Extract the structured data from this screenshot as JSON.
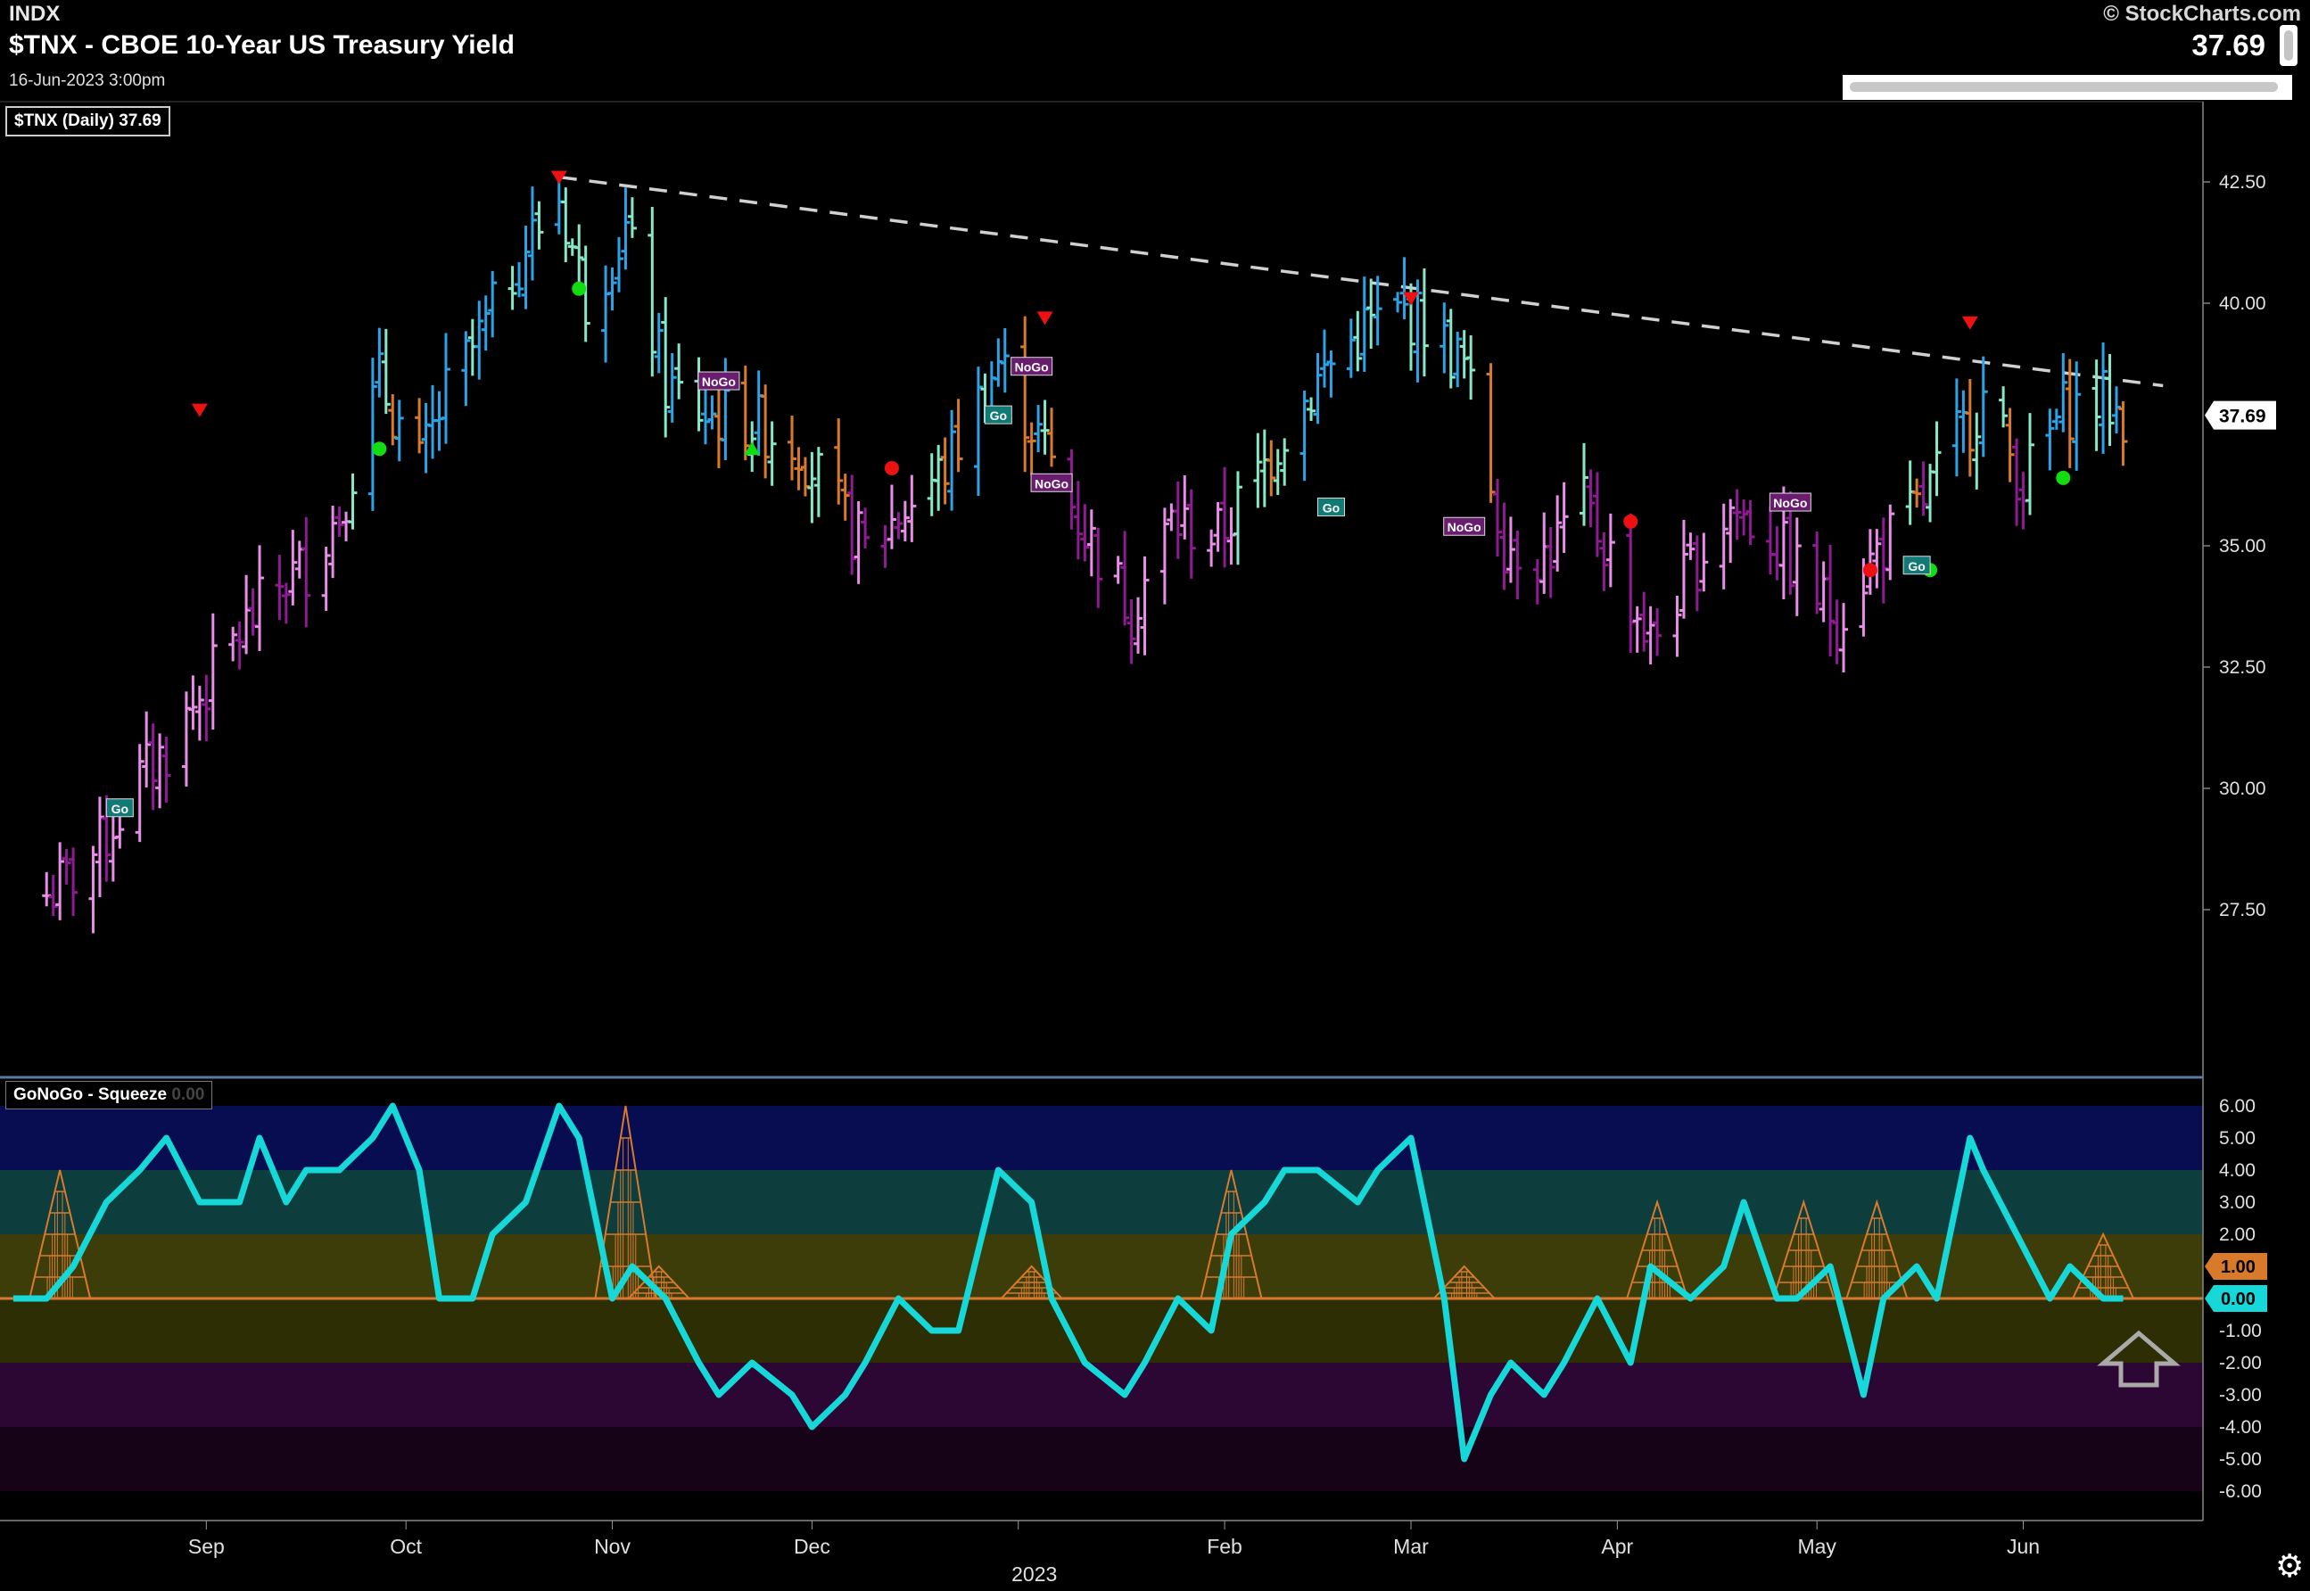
{
  "header": {
    "exchange": "INDX",
    "title": "$TNX - CBOE 10-Year US Treasury Yield",
    "datetime": "16-Jun-2023 3:00pm",
    "copyright": "© StockCharts.com",
    "last_value": "37.69"
  },
  "price_panel": {
    "legend": "$TNX (Daily) 37.69",
    "last_value_tag": "37.69"
  },
  "oscillator_panel": {
    "legend": "GoNoGo - Squeeze",
    "legend_dim": "0.00",
    "tag_upper": "1.00",
    "tag_lower": "0.00"
  },
  "colors": {
    "go_strong": "#2ba3e6",
    "go_weak": "#87e8c8",
    "nogo_strong": "#8e1b94",
    "nogo_weak": "#e88ee8",
    "amber": "#d97a2b",
    "oscillator": "#16d8d8",
    "squeeze": "#d97a2b",
    "trendline": "#d0d0d0",
    "red_marker": "#ee1111",
    "green_marker": "#11dd11"
  },
  "chart_data": [
    {
      "type": "ohlc",
      "title": "$TNX (Daily)",
      "ylim": [
        25.5,
        44.0
      ],
      "y_ticks": [
        "42.50",
        "40.00",
        "35.00",
        "32.50",
        "30.00",
        "27.50"
      ],
      "x_ticks": [
        "Sep",
        "Oct",
        "Nov",
        "Dec",
        "2023",
        "Feb",
        "Mar",
        "Apr",
        "May",
        "Jun"
      ],
      "x_ticks_note": "month labels at start of each month; '2023' printed below January",
      "trendline": {
        "x": [
          "2022-10-24",
          "2023-06-22"
        ],
        "y": [
          42.6,
          38.3
        ],
        "style": "dashed"
      },
      "series_close": {
        "x": [
          "2022-08-08",
          "2022-08-12",
          "2022-08-16",
          "2022-08-22",
          "2022-08-26",
          "2022-08-31",
          "2022-09-06",
          "2022-09-12",
          "2022-09-16",
          "2022-09-21",
          "2022-09-27",
          "2022-10-03",
          "2022-10-07",
          "2022-10-13",
          "2022-10-19",
          "2022-10-24",
          "2022-10-28",
          "2022-11-03",
          "2022-11-09",
          "2022-11-15",
          "2022-11-21",
          "2022-11-29",
          "2022-12-05",
          "2022-12-09",
          "2022-12-15",
          "2022-12-21",
          "2022-12-29",
          "2023-01-05",
          "2023-01-11",
          "2023-01-18",
          "2023-01-24",
          "2023-01-31",
          "2023-02-06",
          "2023-02-10",
          "2023-02-16",
          "2023-02-22",
          "2023-02-28",
          "2023-03-03",
          "2023-03-09",
          "2023-03-15",
          "2023-03-21",
          "2023-03-27",
          "2023-03-31",
          "2023-04-06",
          "2023-04-12",
          "2023-04-18",
          "2023-04-24",
          "2023-04-28",
          "2023-05-04",
          "2023-05-10",
          "2023-05-16",
          "2023-05-22",
          "2023-05-26",
          "2023-06-01",
          "2023-06-07",
          "2023-06-13",
          "2023-06-16"
        ],
        "y": [
          27.8,
          28.2,
          28.8,
          30.2,
          30.8,
          31.9,
          33.2,
          34.2,
          34.6,
          35.7,
          38.4,
          36.6,
          38.1,
          39.5,
          41.2,
          42.2,
          40.1,
          41.5,
          38.3,
          37.7,
          37.6,
          37.1,
          35.7,
          34.9,
          35.8,
          36.6,
          38.8,
          37.0,
          35.3,
          33.7,
          35.5,
          35.2,
          36.4,
          37.4,
          38.6,
          39.5,
          39.8,
          39.6,
          38.7,
          35.1,
          34.8,
          35.8,
          34.8,
          33.0,
          34.5,
          35.8,
          35.2,
          34.5,
          33.5,
          34.9,
          35.7,
          37.2,
          38.0,
          36.3,
          37.8,
          38.0,
          37.69
        ]
      },
      "markers": [
        {
          "type": "down-triangle",
          "color": "red",
          "label": "",
          "x": "2022-08-31",
          "y": 37.8
        },
        {
          "type": "down-triangle",
          "color": "red",
          "label": "",
          "x": "2022-10-24",
          "y": 42.6
        },
        {
          "type": "down-triangle",
          "color": "red",
          "label": "",
          "x": "2023-01-05",
          "y": 39.7
        },
        {
          "type": "down-triangle",
          "color": "red",
          "label": "",
          "x": "2023-03-01",
          "y": 40.1
        },
        {
          "type": "down-triangle",
          "color": "red",
          "label": "",
          "x": "2023-05-24",
          "y": 39.6
        },
        {
          "type": "dot",
          "color": "green",
          "x": "2022-10-27",
          "y": 40.3
        },
        {
          "type": "dot",
          "color": "green",
          "x": "2022-09-27",
          "y": 37.0
        },
        {
          "type": "dot",
          "color": "green",
          "x": "2023-05-18",
          "y": 34.5
        },
        {
          "type": "dot",
          "color": "green",
          "x": "2023-06-07",
          "y": 36.4
        },
        {
          "type": "dot",
          "color": "red",
          "x": "2022-12-13",
          "y": 36.6
        },
        {
          "type": "dot",
          "color": "red",
          "x": "2023-04-03",
          "y": 35.5
        },
        {
          "type": "dot",
          "color": "red",
          "x": "2023-05-09",
          "y": 34.5
        },
        {
          "type": "up-triangle",
          "color": "green",
          "x": "2022-11-22",
          "y": 37.0
        },
        {
          "type": "label",
          "label": "Go",
          "x": "2022-08-19",
          "y": 29.6
        },
        {
          "type": "label",
          "label": "NoGo",
          "x": "2022-11-17",
          "y": 38.4
        },
        {
          "type": "label",
          "label": "Go",
          "x": "2022-12-29",
          "y": 37.7
        },
        {
          "type": "label",
          "label": "NoGo",
          "x": "2023-01-03",
          "y": 38.7
        },
        {
          "type": "label",
          "label": "NoGo",
          "x": "2023-01-06",
          "y": 36.3
        },
        {
          "type": "label",
          "label": "Go",
          "x": "2023-02-17",
          "y": 35.8
        },
        {
          "type": "label",
          "label": "NoGo",
          "x": "2023-03-09",
          "y": 35.4
        },
        {
          "type": "label",
          "label": "NoGo",
          "x": "2023-04-27",
          "y": 35.9
        },
        {
          "type": "label",
          "label": "Go",
          "x": "2023-05-16",
          "y": 34.6
        }
      ]
    },
    {
      "type": "line",
      "title": "GoNoGo - Squeeze",
      "ylim": [
        -7.0,
        6.6
      ],
      "y_ticks": [
        "6.00",
        "5.00",
        "4.00",
        "3.00",
        "2.00",
        "1.00",
        "0.00",
        "-1.00",
        "-2.00",
        "-3.00",
        "-4.00",
        "-5.00",
        "-6.00"
      ],
      "bands": [
        {
          "from": 4,
          "to": 6,
          "color": "#080c50"
        },
        {
          "from": 2,
          "to": 4,
          "color": "#0d3d3d"
        },
        {
          "from": 0,
          "to": 2,
          "color": "#3d3d0a"
        },
        {
          "from": -2,
          "to": 0,
          "color": "#2e2e05"
        },
        {
          "from": -4,
          "to": -2,
          "color": "#2d0733"
        },
        {
          "from": -6,
          "to": -4,
          "color": "#170318"
        }
      ],
      "series": [
        {
          "name": "GoNoGo Oscillator",
          "x": [
            "2022-08-03",
            "2022-08-08",
            "2022-08-12",
            "2022-08-17",
            "2022-08-22",
            "2022-08-26",
            "2022-08-31",
            "2022-09-06",
            "2022-09-09",
            "2022-09-13",
            "2022-09-16",
            "2022-09-21",
            "2022-09-26",
            "2022-09-29",
            "2022-10-03",
            "2022-10-06",
            "2022-10-11",
            "2022-10-14",
            "2022-10-19",
            "2022-10-24",
            "2022-10-27",
            "2022-11-01",
            "2022-11-04",
            "2022-11-09",
            "2022-11-14",
            "2022-11-17",
            "2022-11-22",
            "2022-11-28",
            "2022-12-01",
            "2022-12-06",
            "2022-12-09",
            "2022-12-14",
            "2022-12-19",
            "2022-12-23",
            "2022-12-29",
            "2023-01-03",
            "2023-01-06",
            "2023-01-11",
            "2023-01-17",
            "2023-01-20",
            "2023-01-25",
            "2023-01-30",
            "2023-02-02",
            "2023-02-07",
            "2023-02-10",
            "2023-02-15",
            "2023-02-21",
            "2023-02-24",
            "2023-03-01",
            "2023-03-06",
            "2023-03-09",
            "2023-03-13",
            "2023-03-16",
            "2023-03-21",
            "2023-03-24",
            "2023-03-29",
            "2023-04-03",
            "2023-04-06",
            "2023-04-12",
            "2023-04-17",
            "2023-04-20",
            "2023-04-25",
            "2023-04-28",
            "2023-05-03",
            "2023-05-08",
            "2023-05-11",
            "2023-05-16",
            "2023-05-19",
            "2023-05-24",
            "2023-05-26",
            "2023-05-31",
            "2023-06-05",
            "2023-06-08",
            "2023-06-13",
            "2023-06-16"
          ],
          "y": [
            0,
            0,
            1,
            3,
            4,
            5,
            3,
            3,
            5,
            3,
            4,
            4,
            5,
            6,
            4,
            0,
            0,
            2,
            3,
            6,
            5,
            0,
            1,
            0,
            -2,
            -3,
            -2,
            -3,
            -4,
            -3,
            -2,
            0,
            -1,
            -1,
            4,
            3,
            0,
            -2,
            -3,
            -2,
            0,
            -1,
            2,
            3,
            4,
            4,
            3,
            4,
            5,
            0,
            -5,
            -3,
            -2,
            -3,
            -2,
            0,
            -2,
            1,
            0,
            1,
            3,
            0,
            0,
            1,
            -3,
            0,
            1,
            0,
            5,
            4,
            2,
            0,
            1,
            0,
            0
          ]
        },
        {
          "name": "GoNoGo Squeeze",
          "peaks": [
            {
              "x": "2022-08-10",
              "value": 4
            },
            {
              "x": "2022-11-03",
              "value": 6
            },
            {
              "x": "2022-11-08",
              "value": 1
            },
            {
              "x": "2023-01-03",
              "value": 1
            },
            {
              "x": "2023-02-02",
              "value": 4
            },
            {
              "x": "2023-03-09",
              "value": 1
            },
            {
              "x": "2023-04-07",
              "value": 3
            },
            {
              "x": "2023-04-29",
              "value": 3
            },
            {
              "x": "2023-05-10",
              "value": 3
            },
            {
              "x": "2023-06-13",
              "value": 2
            }
          ]
        }
      ]
    }
  ]
}
